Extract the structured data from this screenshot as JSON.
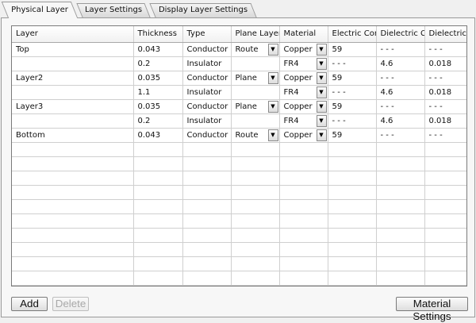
{
  "tabs": [
    "Physical Layer",
    "Layer Settings",
    "Display Layer Settings"
  ],
  "columns": [
    "Layer",
    "Thickness",
    "Type",
    "Plane Layer",
    "Material",
    "Electric Cond",
    "Dielectric Co",
    "Dielectric L"
  ],
  "rows": [
    {
      "layer": "Top",
      "thickness": "0.043",
      "type": "Conductor",
      "plane": "Route",
      "material": "Copper",
      "electric": "59",
      "dielectric_const": "- - -",
      "dielectric_loss": "- - -",
      "plane_dd": true,
      "material_dd": true
    },
    {
      "layer": "",
      "thickness": "0.2",
      "type": "Insulator",
      "plane": "",
      "material": "FR4",
      "electric": "- - -",
      "dielectric_const": "4.6",
      "dielectric_loss": "0.018",
      "plane_dd": false,
      "material_dd": true
    },
    {
      "layer": "Layer2",
      "thickness": "0.035",
      "type": "Conductor",
      "plane": "Plane",
      "material": "Copper",
      "electric": "59",
      "dielectric_const": "- - -",
      "dielectric_loss": "- - -",
      "plane_dd": true,
      "material_dd": true
    },
    {
      "layer": "",
      "thickness": "1.1",
      "type": "Insulator",
      "plane": "",
      "material": "FR4",
      "electric": "- - -",
      "dielectric_const": "4.6",
      "dielectric_loss": "0.018",
      "plane_dd": false,
      "material_dd": true
    },
    {
      "layer": "Layer3",
      "thickness": "0.035",
      "type": "Conductor",
      "plane": "Plane",
      "material": "Copper",
      "electric": "59",
      "dielectric_const": "- - -",
      "dielectric_loss": "- - -",
      "plane_dd": true,
      "material_dd": true
    },
    {
      "layer": "",
      "thickness": "0.2",
      "type": "Insulator",
      "plane": "",
      "material": "FR4",
      "electric": "- - -",
      "dielectric_const": "4.6",
      "dielectric_loss": "0.018",
      "plane_dd": false,
      "material_dd": true
    },
    {
      "layer": "Bottom",
      "thickness": "0.043",
      "type": "Conductor",
      "plane": "Route",
      "material": "Copper",
      "electric": "59",
      "dielectric_const": "- - -",
      "dielectric_loss": "- - -",
      "plane_dd": true,
      "material_dd": true
    }
  ],
  "empty_rows": 10,
  "buttons": {
    "add": "Add",
    "delete": "Delete",
    "material_settings": "Material Settings"
  },
  "icons": {
    "dropdown": "▼"
  }
}
